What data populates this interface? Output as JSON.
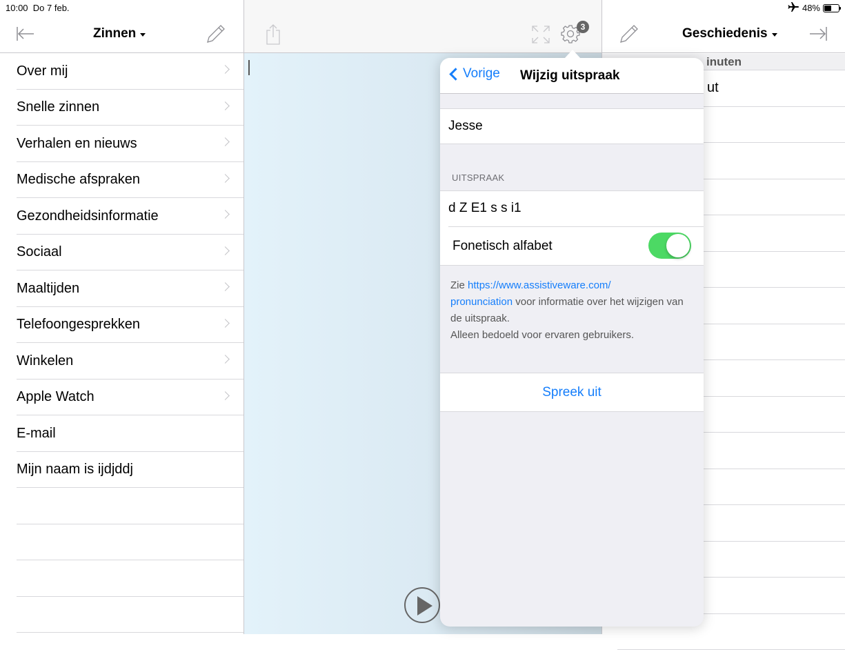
{
  "status": {
    "time": "10:00",
    "date": "Do 7 feb.",
    "battery": "48%",
    "battery_level": 48,
    "airplane_icon": "airplane-icon"
  },
  "left": {
    "title": "Zinnen",
    "items": [
      {
        "label": "Over mij",
        "chevron": true
      },
      {
        "label": "Snelle zinnen",
        "chevron": true
      },
      {
        "label": "Verhalen en nieuws",
        "chevron": true
      },
      {
        "label": "Medische afspraken",
        "chevron": true
      },
      {
        "label": "Gezondheidsinformatie",
        "chevron": true
      },
      {
        "label": "Sociaal",
        "chevron": true
      },
      {
        "label": "Maaltijden",
        "chevron": true
      },
      {
        "label": "Telefoongesprekken",
        "chevron": true
      },
      {
        "label": "Winkelen",
        "chevron": true
      },
      {
        "label": "Apple Watch",
        "chevron": true
      },
      {
        "label": "E-mail",
        "chevron": false
      },
      {
        "label": "Mijn naam is ijdjddj",
        "chevron": false
      },
      {
        "label": "",
        "chevron": false
      },
      {
        "label": "",
        "chevron": false
      },
      {
        "label": "",
        "chevron": false
      },
      {
        "label": "",
        "chevron": false
      }
    ]
  },
  "middle": {
    "settings_badge": "3"
  },
  "right": {
    "title": "Geschiedenis",
    "section": "inuten",
    "first_row": "ut"
  },
  "popover": {
    "back_label": "Vorige",
    "title": "Wijzig uitspraak",
    "word": "Jesse",
    "section_header": "UITSPRAAK",
    "pronunciation": "d Z E1 s s i1",
    "phonetic_label": "Fonetisch alfabet",
    "phonetic_on": true,
    "footer_prefix": "Zie ",
    "footer_link": "https://www.assistiveware.com/pronunciation",
    "footer_link_line1": "https://www.assistiveware.com/",
    "footer_link_line2": "pronunciation",
    "footer_rest": " voor informatie over het wijzigen van de uitspraak.",
    "footer_note": "Alleen bedoeld voor ervaren gebruikers.",
    "speak_label": "Spreek uit"
  },
  "colors": {
    "accent": "#157efb",
    "toggle_on": "#4cd964"
  }
}
